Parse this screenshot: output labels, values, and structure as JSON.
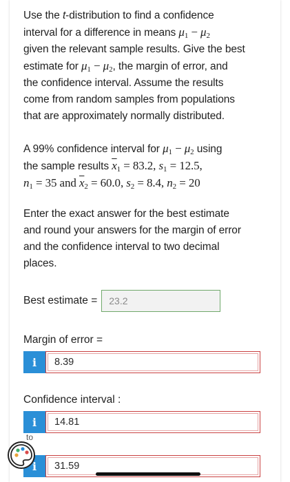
{
  "intro": {
    "line1_a": "Use the ",
    "line1_t": "t",
    "line1_b": "-distribution to find a confidence",
    "line2": "interval for a difference in means ",
    "line3": "given the relevant sample results. Give the best",
    "line4_a": "estimate for ",
    "line4_b": ", the margin of error, and",
    "line5": "the confidence interval. Assume the results",
    "line6": "come from random samples from populations",
    "line7": "that are approximately normally distributed."
  },
  "problem": {
    "line1_a": "A 99% confidence interval for ",
    "line1_b": " using",
    "line2_a": "the sample results ",
    "x1_val": " = 83.2, ",
    "s1_val": " = 12.5,",
    "n1_val": " = 35 and ",
    "x2_val": " = 60.0, ",
    "s2_val": " = 8.4, ",
    "n2_val": " = 20"
  },
  "instructions": {
    "line1": "Enter the exact answer for the best estimate",
    "line2": "and round your answers for the margin of error",
    "line3": "and the confidence interval to two decimal",
    "line4": "places."
  },
  "best_estimate": {
    "label": "Best estimate =",
    "value": "23.2"
  },
  "margin": {
    "label": "Margin of error =",
    "value": "8.39"
  },
  "ci": {
    "label": "Confidence interval :",
    "lower": "14.81",
    "upper": "31.59",
    "connector": "to"
  },
  "info_icon_glyph": "i",
  "colors": {
    "info_blue": "#2a8fd7",
    "error_red": "#c94040",
    "correct_green": "#6fa86a"
  }
}
